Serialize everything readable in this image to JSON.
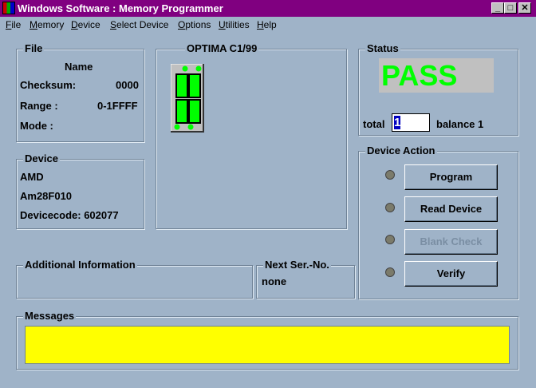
{
  "window": {
    "title": "Windows Software :  Memory Programmer",
    "minimize": "_",
    "maximize": "□",
    "close": "✕"
  },
  "menu": [
    "File",
    "Memory",
    "Device",
    "Select Device",
    "Options",
    "Utilities",
    "Help"
  ],
  "file": {
    "legend": "File",
    "name_label": "Name",
    "checksum_label": "Checksum:",
    "checksum": "0000",
    "range_label": "Range :",
    "range": "0-1FFFF",
    "mode_label": "Mode :"
  },
  "device": {
    "legend": "Device",
    "manufacturer": "AMD",
    "part": "Am28F010",
    "devicecode": "Devicecode: 602077"
  },
  "programmer": {
    "name": "OPTIMA  C1/99"
  },
  "status": {
    "legend": "Status",
    "result": "PASS",
    "result_color": "#00ff00",
    "total_label": "total",
    "total": "1",
    "balance": "balance 1"
  },
  "device_action": {
    "legend": "Device Action",
    "buttons": [
      "Program",
      "Read Device",
      "Blank Check",
      "Verify"
    ]
  },
  "additional": {
    "legend": "Additional Information"
  },
  "next_serial": {
    "legend": "Next Ser.-No.",
    "value": "none"
  },
  "messages": {
    "legend": "Messages",
    "color": "#ffff00"
  }
}
